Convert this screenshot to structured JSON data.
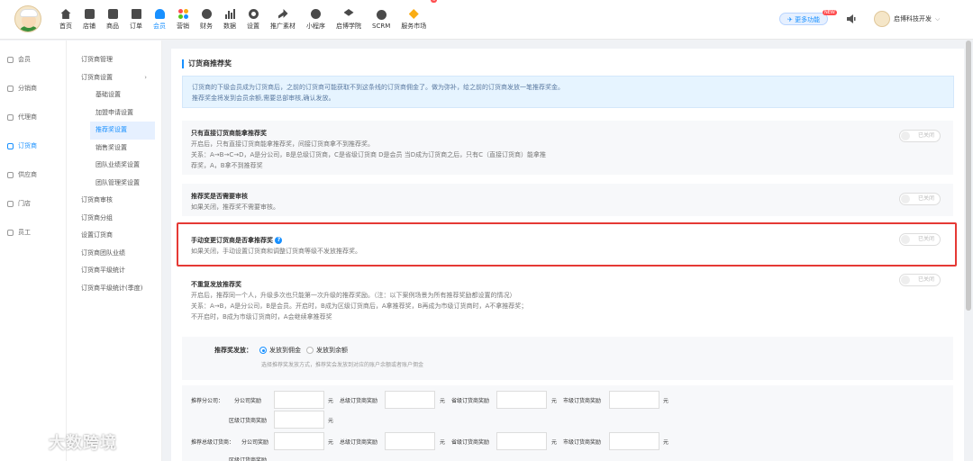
{
  "nav": [
    {
      "label": "首页",
      "icon": "home-icon"
    },
    {
      "label": "店铺",
      "icon": "shop-icon"
    },
    {
      "label": "商品",
      "icon": "goods-icon"
    },
    {
      "label": "订单",
      "icon": "order-icon"
    },
    {
      "label": "会员",
      "icon": "member-icon",
      "active": true
    },
    {
      "label": "营销",
      "icon": "marketing-icon"
    },
    {
      "label": "财务",
      "icon": "finance-icon"
    },
    {
      "label": "数据",
      "icon": "data-icon"
    },
    {
      "label": "设置",
      "icon": "settings-icon"
    },
    {
      "label": "推广素材",
      "icon": "share-icon"
    },
    {
      "label": "小程序",
      "icon": "miniprogram-icon"
    },
    {
      "label": "启博学院",
      "icon": "academy-icon"
    },
    {
      "label": "SCRM",
      "icon": "scrm-icon"
    },
    {
      "label": "服务市场",
      "icon": "market-icon"
    }
  ],
  "header": {
    "more_label": "更多功能",
    "new_tag": "NEW",
    "user_name": "启博科技开发"
  },
  "sidebar1": [
    "会员",
    "分销商",
    "代理商",
    "订货商",
    "供应商",
    "门店",
    "员工"
  ],
  "sidebar2": {
    "items": [
      "订货商管理",
      "订货商设置"
    ],
    "sub": [
      "基础设置",
      "加盟申请设置",
      "推荐奖设置",
      "销售奖设置",
      "团队业绩奖设置",
      "团队管理奖设置"
    ],
    "rest": [
      "订货商审核",
      "订货商分组",
      "设置订货商",
      "订货商团队业绩",
      "订货商平级统计",
      "订货商平级统计(季度)"
    ]
  },
  "page": {
    "section_title": "订货商推荐奖",
    "info_line1": "订货商的下级会员成为订货商后，之前的订货商可能获取不到这条线的订货商佣金了。做为弥补，给之前的订货商发放一笔推荐奖金。",
    "info_line2": "推荐奖金将发到会员余额,需要总部审核,确认发放。",
    "toggle_off": "已关闭"
  },
  "cards": [
    {
      "title": "只有直接订货商能拿推荐奖",
      "desc": [
        "开启后，只有直接订货商能拿推荐奖，间接订货商拿不到推荐奖。",
        "关系：A→B→C→D，A是分公司，B是总级订货商，C是省级订货商 D是会员 当D成为订货商之后，只有C（直接订货商）能拿推",
        "荐奖，A，B拿不到推荐奖"
      ]
    },
    {
      "title": "推荐奖是否需要审核",
      "desc": [
        "如果关闭，推荐奖不需要审核。"
      ]
    },
    {
      "title": "手动变更订货商是否拿推荐奖",
      "desc": [
        "如果关闭，手动设置订货商和调整订货商等级不发放推荐奖。"
      ]
    },
    {
      "title": "不重复发放推荐奖",
      "desc": [
        "开启后，推荐同一个人，升级多次也只能第一次升级的推荐奖励。（注：以下案例场景为所有推荐奖励都设置的情况）",
        "关系：A→B，A是分公司，B是会员。开启时，B成为区级订货商后，A拿推荐奖，B再成为市级订货商时，A不拿推荐奖；",
        "不开启时，B成为市级订货商时，A会继续拿推荐奖"
      ]
    }
  ],
  "radio": {
    "label": "推荐奖发放：",
    "opt1": "发放到佣金",
    "opt2": "发放到余额",
    "hint": "选择推荐奖发放方式，推荐奖会发放到对应的账户余额或者账户佣金"
  },
  "rewards": {
    "row1_head": "推荐分公司：",
    "row2_head": "推荐总级订货商：",
    "labels": [
      "分公司奖励",
      "总级订货商奖励",
      "省级订货商奖励",
      "市级订货商奖励",
      "区级订货商奖励"
    ],
    "unit": "元"
  },
  "watermark": "大数跨境"
}
